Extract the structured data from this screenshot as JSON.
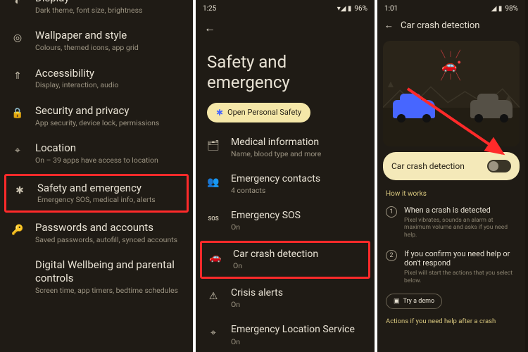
{
  "pane1": {
    "items": [
      {
        "icon": "◐",
        "title": "Display",
        "sub": "Dark theme, font size, brightness"
      },
      {
        "icon": "◎",
        "title": "Wallpaper and style",
        "sub": "Colours, themed icons, app grid"
      },
      {
        "icon": "⇑",
        "title": "Accessibility",
        "sub": "Display, interaction, audio"
      },
      {
        "icon": "🔒",
        "title": "Security and privacy",
        "sub": "App security, device lock, permissions"
      },
      {
        "icon": "⌖",
        "title": "Location",
        "sub": "On – 39 apps have access to location"
      },
      {
        "icon": "✱",
        "title": "Safety and emergency",
        "sub": "Emergency SOS, medical info, alerts"
      },
      {
        "icon": "🔑",
        "title": "Passwords and accounts",
        "sub": "Saved passwords, autofill, synced accounts"
      },
      {
        "icon": "",
        "title": "Digital Wellbeing and parental controls",
        "sub": "Screen time, app timers, bedtime schedules"
      }
    ],
    "highlight_index": 5
  },
  "pane2": {
    "status_time": "1:25",
    "status_battery": "96%",
    "heading": "Safety and emergency",
    "chip_label": "Open Personal Safety",
    "items": [
      {
        "icon": "🗂",
        "title": "Medical information",
        "sub": "Name, blood type and more"
      },
      {
        "icon": "👥",
        "title": "Emergency contacts",
        "sub": "4 contacts"
      },
      {
        "icon": "sos",
        "title": "Emergency SOS",
        "sub": "On"
      },
      {
        "icon": "🚗",
        "title": "Car crash detection",
        "sub": "On"
      },
      {
        "icon": "⚠",
        "title": "Crisis alerts",
        "sub": "On"
      },
      {
        "icon": "⌖",
        "title": "Emergency Location Service",
        "sub": "On"
      }
    ],
    "highlight_index": 3
  },
  "pane3": {
    "status_time": "1:01",
    "status_battery": "98%",
    "header": "Car crash detection",
    "toggle_label": "Car crash detection",
    "toggle_on": false,
    "section": "How it works",
    "steps": [
      {
        "n": "1",
        "t": "When a crash is detected",
        "s": "Pixel vibrates, sounds an alarm at maximum volume and asks if you need help."
      },
      {
        "n": "2",
        "t": "If you confirm you need help or don't respond",
        "s": "Pixel will start the actions that you select below."
      }
    ],
    "demo": "Try a demo",
    "footer": "Actions if you need help after a crash"
  }
}
